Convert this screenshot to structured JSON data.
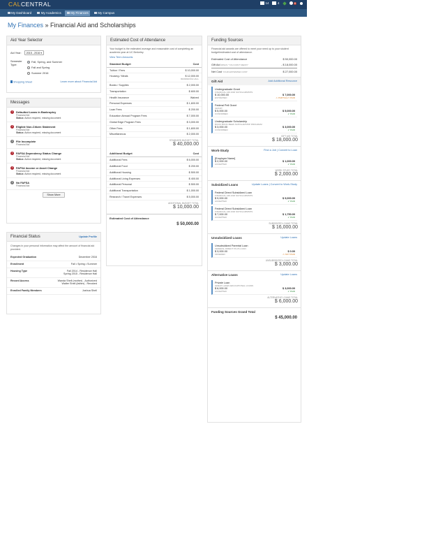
{
  "brand": {
    "prefix": "CAL",
    "suffix": "CENTRAL"
  },
  "topbar": {
    "mail_count": "14",
    "cal_count": "4",
    "alert_count": "6"
  },
  "nav": [
    "My Dashboard",
    "My Academics",
    "My Finances",
    "My Campus"
  ],
  "page": {
    "crumb": "My Finances",
    "sep": " » ",
    "title": "Financial Aid and Scholarships"
  },
  "aid_year": {
    "title": "Aid Year Selector",
    "year_label": "Aid Year:",
    "year_value": "2015 - 2016",
    "semester_label": "Semester Type:",
    "options": [
      "Fall, Spring, and Summer",
      "Fall and Spring",
      "Summer 2016"
    ],
    "link_left": "Shopping Sheet",
    "link_right": "Learn more about Financial Aid"
  },
  "messages": {
    "title": "Messages",
    "items": [
      {
        "t": "Defaulted Loans in Bankruptcy",
        "s": "Financial Aid",
        "st": "Action required, missing document"
      },
      {
        "t": "Eligible Non-Citizen Statement",
        "s": "Financial Aid",
        "st": "Action required, missing document"
      },
      {
        "t": "File Incomplete",
        "s": "Financial Aid"
      },
      {
        "t": "FAFSA Dependency Status Change",
        "s": "Financial Aid",
        "st": "Action required, missing document"
      },
      {
        "t": "FAFSA Income or Asset Change",
        "s": "Financial Aid",
        "st": "Action required, missing document"
      },
      {
        "t": "No FAFSA",
        "s": "Financial Aid"
      }
    ],
    "status_label": "Status:",
    "show_more": "Show More"
  },
  "fin_status": {
    "title": "Financial Status",
    "link": "Update Profile",
    "intro": "Changes in your personal information may affect the amount of financial aid provided.",
    "rows": [
      {
        "k": "Expected Graduation",
        "v": "December 2016"
      },
      {
        "k": "Enrollment",
        "v": "Fall • Spring • Summer"
      },
      {
        "k": "Housing Type",
        "v": "Fall 2014 - Residence Hall",
        "v2": "Spring 2015 - Residence Hall"
      },
      {
        "k": "Record Access",
        "v": "Wanda Shell (mother) - Authorized",
        "v2": "Walter Shell (father) - Revoked"
      },
      {
        "k": "Enrolled Family Members",
        "v": "Joshua Shell"
      }
    ]
  },
  "coa": {
    "title": "Estimated Cost of Attendance",
    "intro": "Your budget is the estimated average and reasonable cost of completing an academic year at UC Berkeley.",
    "terms_link": "View Term Amounts",
    "std_head": "Standard Budget",
    "cost_head": "Cost",
    "std": [
      {
        "k": "Tuition / Fees",
        "v": "$ 10,000.00"
      },
      {
        "k": "Housing / Meals",
        "v": "$ 12,000.00",
        "v2": "RESIDENCE HALL"
      },
      {
        "k": "Books / Supplies",
        "v": "$ 2,000.00"
      },
      {
        "k": "Transportation",
        "v": "$ 600.00"
      },
      {
        "k": "Health Insurance",
        "v": "Waived"
      },
      {
        "k": "Personal Expenses",
        "v": "$ 1,600.00"
      },
      {
        "k": "Loan Fees",
        "v": "$ 200.00"
      },
      {
        "k": "Education Abroad Program Fees",
        "v": "$ 7,000.00"
      },
      {
        "k": "Global Edge Program Fees",
        "v": "$ 3,000.00"
      },
      {
        "k": "Other Fees",
        "v": "$ 1,600.00"
      },
      {
        "k": "Miscellaneous",
        "v": "$ 2,000.00"
      }
    ],
    "std_total_label": "STANDARD BUDGET TOTAL",
    "std_total": "$ 40,000.00",
    "add_head": "Additional Budget",
    "add": [
      {
        "k": "Additional Fees",
        "v": "$ 6,000.00"
      },
      {
        "k": "Additional Food",
        "v": "$ 200.00"
      },
      {
        "k": "Additional Housing",
        "v": "$ 500.00"
      },
      {
        "k": "Additional Living Expenses",
        "v": "$ 400.00"
      },
      {
        "k": "Additional Personal",
        "v": "$ 500.00"
      },
      {
        "k": "Additional Transportation",
        "v": "$ 1,000.00"
      },
      {
        "k": "Research / Travel Expenses",
        "v": "$ 5,000.00"
      }
    ],
    "add_total_label": "ADDITIONAL BUDGET TOTAL",
    "add_total": "$ 10,000.00",
    "grand_label": "Estimated Cost of Attendance",
    "grand": "$ 50,000.00"
  },
  "funding": {
    "title": "Funding Sources",
    "intro": "Financial aid awards are offered to meet your need up to your student budget/estimated cost of attendance.",
    "eca": "Estimated Cost of Attendance",
    "eca_v": "$ 50,000.00",
    "gift_k": "Gift Aid",
    "gift_note": "MINUS \"YOU DON'T REPAY\"",
    "gift_v": "- $ 18,000.00",
    "net_k": "Net Cost",
    "net_note": "YOUR ESTIMATED COST",
    "net_v": "$ 27,000.00",
    "gift": {
      "title": "Gift Aid",
      "link": "Add Additional Resource",
      "items": [
        {
          "n": "Undergraduate Grant",
          "d": "FINANCIAL AID AND SCHOLARSHIPS",
          "a": "$ 10,000.00",
          "s": "ESTIMATED",
          "a2": "$ 7,000.00",
          "f": "PARTIALLY PAID"
        },
        {
          "n": "Federal Pell Grant",
          "d": "GRANT",
          "a": "$ 5,000.00",
          "s": "CONFIRMED",
          "a2": "$ 5,000.00",
          "f": "PAID"
        },
        {
          "n": "Undergraduate Scholarship",
          "d": "BOOK BOOK BEES SCHOLARSHIP PROGRAM",
          "a": "$ 3,000.00",
          "s": "CONFIRMED",
          "a2": "$ 3,000.00",
          "f": "PAID"
        }
      ],
      "total_label": "GIFT AID TOTAL",
      "total": "$ 18,000.00"
    },
    "work": {
      "title": "Work-Study",
      "link": "Find a Job | Convert to Loan",
      "items": [
        {
          "n": "[Employer Name]",
          "a": "$ 2,000.00",
          "s": "ACCEPTED",
          "a2": "$ 1,000.00",
          "f": "PAID"
        }
      ],
      "total_label": "WORK STUDY TOTAL",
      "total": "$ 2,000.00"
    },
    "sub": {
      "title": "Subsidized Loans",
      "link": "Update Loans | Convert to Work-Study",
      "items": [
        {
          "n": "Federal Direct Subsidized Loan",
          "d": "FINANCIAL AID AND SCHOLARSHIPS",
          "a": "$ 9,000.00",
          "s": "ACCEPTED",
          "a2": "$ 9,000.00",
          "f": "PAID"
        },
        {
          "n": "Federal Direct Subsidized Loan",
          "d": "FINANCIAL AID AND SCHOLARSHIPS",
          "a": "$ 7,000.00",
          "s": "ACCEPTED",
          "a2": "$ 1,750.00",
          "f": "PAID"
        }
      ],
      "total_label": "SUBSIDIZED LOANS TOTAL",
      "total": "$ 16,000.00"
    },
    "unsub": {
      "title": "Unsubsidized Loans",
      "link": "Update Loans",
      "items": [
        {
          "n": "Unsubsidized Parental Loan",
          "d": "FEDERAL DIRECT PLUS LOAN",
          "a": "$ 3,000.00",
          "s": "OFFERED",
          "a2": "$ 0.00",
          "f": "NOT PAID"
        }
      ],
      "total_label": "UNSUBSIDIZED LOANS TOTAL",
      "total": "$ 3,000.00"
    },
    "alt": {
      "title": "Alternative Loans",
      "link": "Update Loans",
      "items": [
        {
          "n": "Private Loan",
          "d": "GREAT LAKES EDUCATIONAL LOANS",
          "a": "$ 6,000.00",
          "s": "ACCEPTED",
          "a2": "$ 3,000.00",
          "f": "PAID"
        }
      ],
      "total_label": "ALTERNATIVE LOANS TOTAL",
      "total": "$ 6,000.00"
    },
    "grand_label": "Funding Sources Grand Total",
    "grand": "$ 45,000.00"
  }
}
